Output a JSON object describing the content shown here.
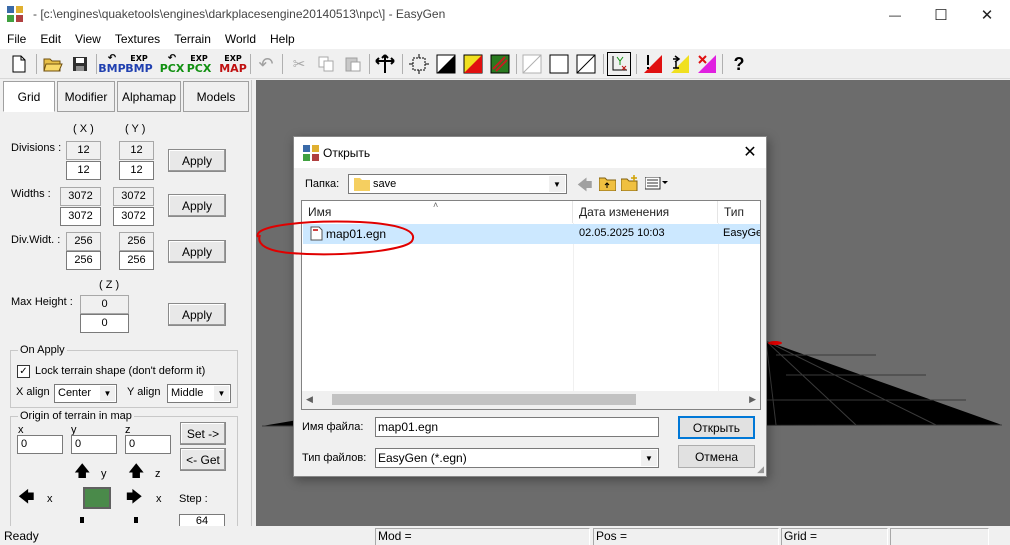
{
  "window": {
    "title": "- [c:\\engines\\quaketools\\engines\\darkplacesengine20140513\\npc\\] - EasyGen",
    "minimize": "—",
    "maximize": "☐",
    "close": "✕"
  },
  "menu": [
    "File",
    "Edit",
    "View",
    "Textures",
    "Terrain",
    "World",
    "Help"
  ],
  "toolbar": {
    "bmp": "BMP",
    "exp": "EXP",
    "pcx": "PCX",
    "map": "MAP",
    "help": "?"
  },
  "tabs": [
    "Grid",
    "Modifier",
    "Alphamap",
    "Models"
  ],
  "grid": {
    "col_x": "( X )",
    "col_y": "( Y )",
    "col_z": "( Z )",
    "divisions_label": "Divisions :",
    "divisions_x_current": "12",
    "divisions_y_current": "12",
    "divisions_x": "12",
    "divisions_y": "12",
    "widths_label": "Widths :",
    "widths_x_current": "3072",
    "widths_y_current": "3072",
    "widths_x": "3072",
    "widths_y": "3072",
    "divwidth_label": "Div.Widt. :",
    "divwidth_x_current": "256",
    "divwidth_y_current": "256",
    "divwidth_x": "256",
    "divwidth_y": "256",
    "maxheight_label": "Max Height :",
    "maxheight_current": "0",
    "maxheight": "0",
    "apply_label": "Apply"
  },
  "on_apply": {
    "title": "On Apply",
    "lock_label": "Lock terrain shape (don't deform it)",
    "lock_checked": true,
    "check_mark": "✓",
    "xalign_label": "X align",
    "xalign_value": "Center",
    "yalign_label": "Y align",
    "yalign_value": "Middle"
  },
  "origin": {
    "title": "Origin of terrain in map",
    "x_label": "x",
    "y_label": "y",
    "z_label": "z",
    "x_value": "0",
    "y_value": "0",
    "z_value": "0",
    "set_label": "Set ->",
    "get_label": "<- Get",
    "step_label": "Step :",
    "step_value": "64",
    "arrow_y": "y",
    "arrow_z": "z",
    "arrow_x_left": "x",
    "arrow_x_right": "x"
  },
  "status": {
    "ready": "Ready",
    "mod": "Mod =",
    "pos": "Pos =",
    "grid": "Grid ="
  },
  "dialog": {
    "title": "Открыть",
    "folder_label": "Папка:",
    "folder_value": "save",
    "columns": [
      "Имя",
      "Дата изменения",
      "Тип"
    ],
    "files": [
      {
        "name": "map01.egn",
        "date": "02.05.2025 10:03",
        "type": "EasyGen"
      }
    ],
    "filename_label": "Имя файла:",
    "filename_value": "map01.egn",
    "filetype_label": "Тип файлов:",
    "filetype_value": "EasyGen (*.egn)",
    "open_button": "Открыть",
    "cancel_button": "Отмена"
  },
  "colors": {
    "viewport_bg": "#6c6c6c",
    "annotation": "#e00000",
    "selection": "#cce8ff"
  }
}
